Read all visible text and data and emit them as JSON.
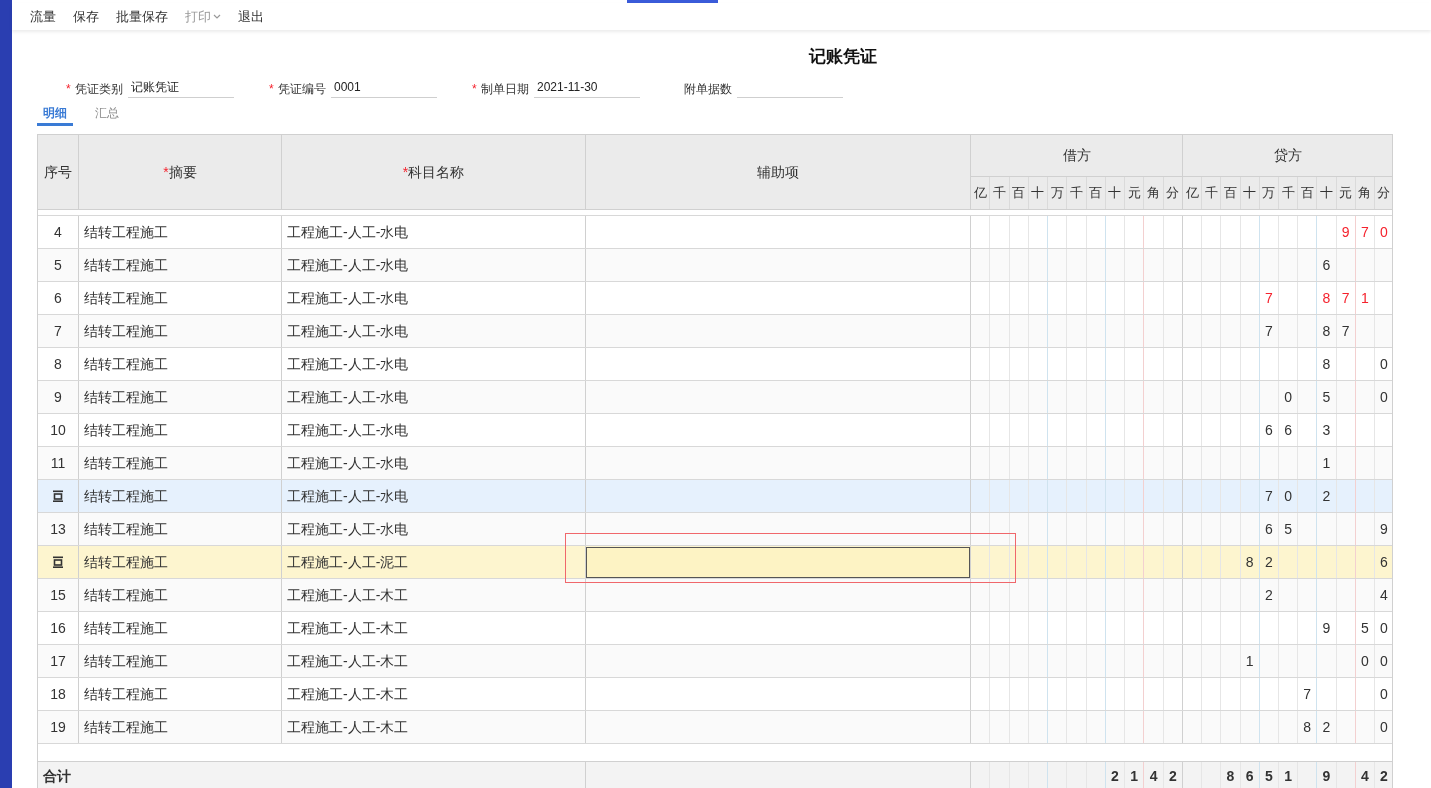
{
  "toolbar": [
    {
      "label": "流量",
      "disabled": false,
      "has_menu": false
    },
    {
      "label": "保存",
      "disabled": false,
      "has_menu": false
    },
    {
      "label": "批量保存",
      "disabled": false,
      "has_menu": false
    },
    {
      "label": "打印",
      "disabled": true,
      "has_menu": true
    },
    {
      "label": "退出",
      "disabled": false,
      "has_menu": false
    }
  ],
  "title": "记账凭证",
  "fields": [
    {
      "marker": "*",
      "label": "凭证类别",
      "value": "记账凭证"
    },
    {
      "marker": "*",
      "label": "凭证编号",
      "value": "0001"
    },
    {
      "marker": "*",
      "label": "制单日期",
      "value": "2021-11-30"
    },
    {
      "label": "附单据数"
    }
  ],
  "tabs": [
    {
      "label": "明细",
      "selected": true
    },
    {
      "label": "汇总",
      "selected": false
    }
  ],
  "table": {
    "columns": [
      {
        "label": "序号"
      },
      {
        "marker": "*",
        "label": "摘要"
      },
      {
        "marker": "*",
        "label": "科目名称"
      },
      {
        "label": "辅助项"
      }
    ],
    "debit": {
      "label": "借方",
      "units": [
        "亿",
        "千",
        "百",
        "十",
        "万",
        "千",
        "百",
        "十",
        "元",
        "角",
        "分"
      ]
    },
    "credit": {
      "label": "贷方",
      "units": [
        "亿",
        "千",
        "百",
        "十",
        "万",
        "千",
        "百",
        "十",
        "元",
        "角",
        "分"
      ]
    },
    "rows": [
      {
        "seq": "4",
        "summary": "结转工程施工",
        "account": "工程施工-人工-水电",
        "hovered": false,
        "selected": false,
        "negative": true,
        "credit": {
          "yuan": "9",
          "jiao": "7",
          "fen": "0"
        }
      },
      {
        "seq": "5",
        "summary": "结转工程施工",
        "account": "工程施工-人工-水电",
        "hovered": false,
        "selected": false,
        "negative": false,
        "credit": {
          "shi": "6"
        }
      },
      {
        "seq": "6",
        "summary": "结转工程施工",
        "account": "工程施工-人工-水电",
        "hovered": false,
        "selected": false,
        "negative": true,
        "credit": {
          "wan": "7",
          "shi": "8",
          "yuan": "7",
          "jiao": "1"
        }
      },
      {
        "seq": "7",
        "summary": "结转工程施工",
        "account": "工程施工-人工-水电",
        "hovered": false,
        "selected": false,
        "negative": false,
        "credit": {
          "wan": "7",
          "shi": "8",
          "yuan": "7"
        }
      },
      {
        "seq": "8",
        "summary": "结转工程施工",
        "account": "工程施工-人工-水电",
        "hovered": false,
        "selected": false,
        "negative": false,
        "credit": {
          "shi": "8",
          "fen": "0"
        }
      },
      {
        "seq": "9",
        "summary": "结转工程施工",
        "account": "工程施工-人工-水电",
        "hovered": false,
        "selected": false,
        "negative": false,
        "credit": {
          "qian": "0",
          "shi": "5",
          "fen": "0"
        }
      },
      {
        "seq": "10",
        "summary": "结转工程施工",
        "account": "工程施工-人工-水电",
        "hovered": false,
        "selected": false,
        "negative": false,
        "credit": {
          "wan": "6",
          "qian": "6",
          "shi": "3"
        }
      },
      {
        "seq": "11",
        "summary": "结转工程施工",
        "account": "工程施工-人工-水电",
        "hovered": false,
        "selected": false,
        "negative": false,
        "credit": {
          "shi": "1"
        }
      },
      {
        "row_tools": true,
        "summary": "结转工程施工",
        "account": "工程施工-人工-水电",
        "hovered": true,
        "selected": false,
        "negative": false,
        "credit": {
          "wan": "7",
          "qian": "0",
          "shi": "2"
        }
      },
      {
        "seq": "13",
        "summary": "结转工程施工",
        "account": "工程施工-人工-水电",
        "hovered": false,
        "selected": false,
        "negative": false,
        "credit": {
          "wan": "6",
          "qian": "5",
          "fen": "9"
        }
      },
      {
        "row_tools": true,
        "editing": true,
        "marked": true,
        "summary": "结转工程施工",
        "account": "工程施工-人工-泥工",
        "hovered": false,
        "selected": true,
        "negative": false,
        "credit": {
          "shiwan": "8",
          "wan": "2",
          "fen": "6"
        }
      },
      {
        "seq": "15",
        "summary": "结转工程施工",
        "account": "工程施工-人工-木工",
        "hovered": false,
        "selected": false,
        "negative": false,
        "credit": {
          "wan": "2",
          "fen": "4"
        }
      },
      {
        "seq": "16",
        "summary": "结转工程施工",
        "account": "工程施工-人工-木工",
        "hovered": false,
        "selected": false,
        "negative": false,
        "credit": {
          "shi": "9",
          "jiao": "5",
          "fen": "0"
        }
      },
      {
        "seq": "17",
        "summary": "结转工程施工",
        "account": "工程施工-人工-木工",
        "hovered": false,
        "selected": false,
        "negative": false,
        "credit": {
          "shiwan": "1",
          "jiao": "0",
          "fen": "0"
        }
      },
      {
        "seq": "18",
        "summary": "结转工程施工",
        "account": "工程施工-人工-木工",
        "hovered": false,
        "selected": false,
        "negative": false,
        "credit": {
          "bai": "7",
          "fen": "0"
        }
      },
      {
        "seq": "19",
        "summary": "结转工程施工",
        "account": "工程施工-人工-木工",
        "hovered": false,
        "selected": false,
        "negative": false,
        "credit": {
          "bai": "8",
          "shi": "2",
          "fen": "0"
        }
      }
    ],
    "total": {
      "label": "合计",
      "debit": {
        "shi": "2",
        "yuan": "1",
        "jiao": "4",
        "fen": "2"
      },
      "credit": {
        "baiwan": "8",
        "shiwan": "6",
        "wan": "5",
        "qian": "1",
        "shi": "9",
        "jiao": "4",
        "fen": "2"
      }
    }
  }
}
